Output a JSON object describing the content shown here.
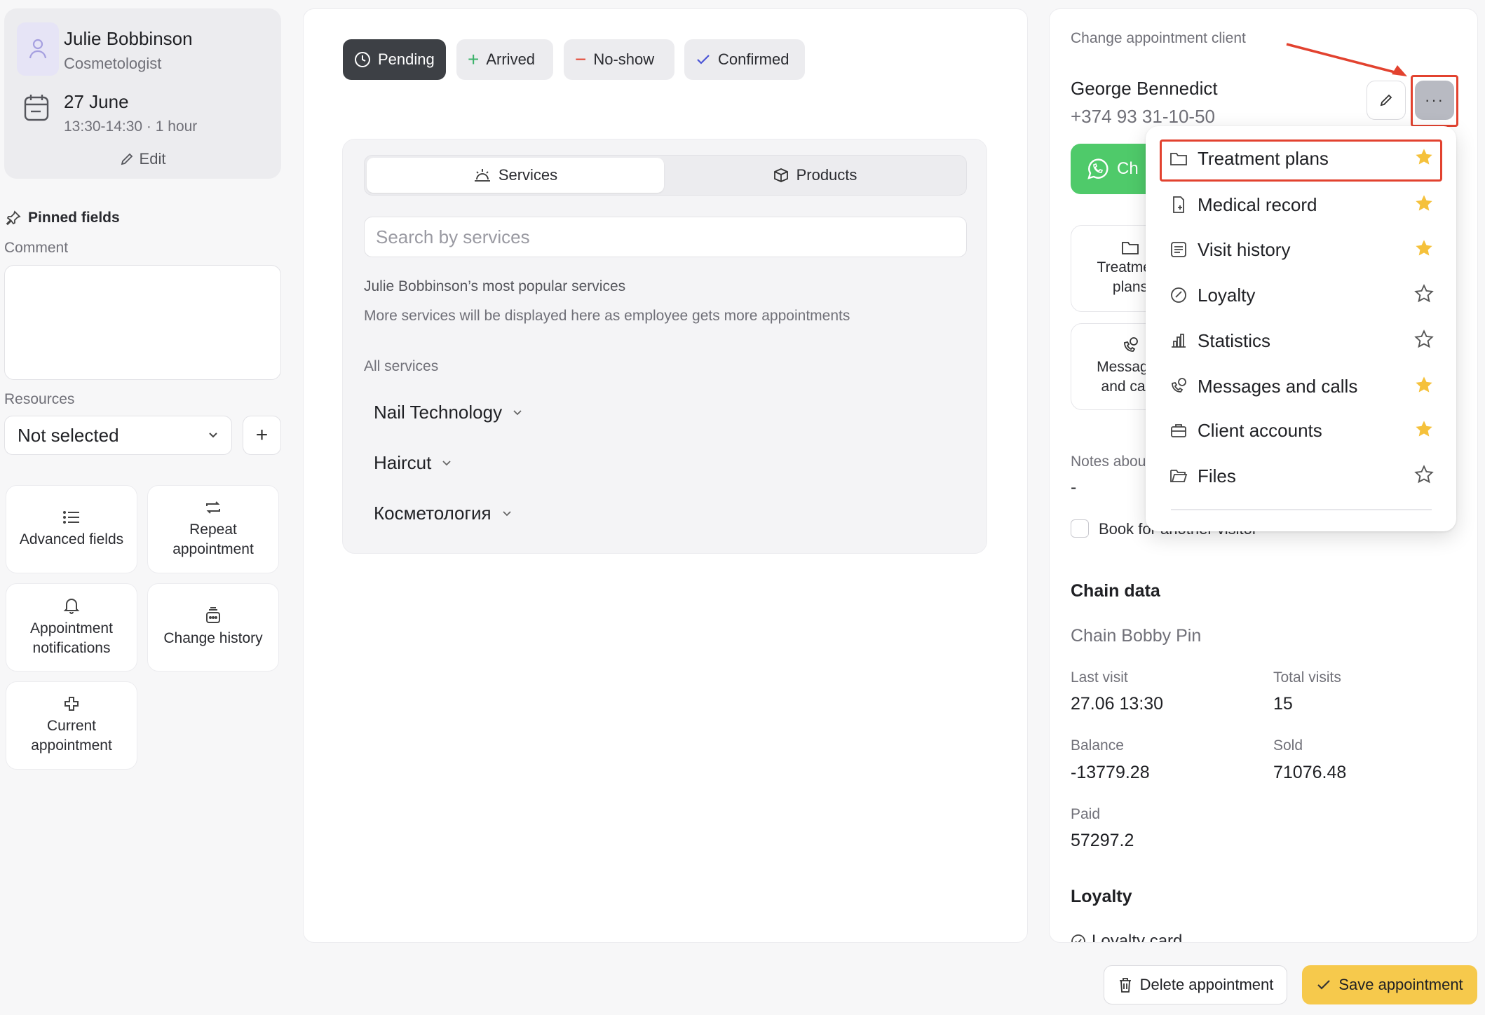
{
  "employee": {
    "name": "Julie Bobbinson",
    "role": "Cosmetologist",
    "date": "27 June",
    "time": "13:30-14:30 · 1 hour",
    "edit_label": "Edit"
  },
  "left": {
    "pinned_label": "Pinned fields",
    "comment_label": "Comment",
    "resources_label": "Resources",
    "resources_value": "Not selected",
    "tiles": [
      {
        "label": "Advanced fields",
        "icon": "list-icon"
      },
      {
        "label": "Repeat appointment",
        "icon": "repeat-icon"
      },
      {
        "label": "Appointment notifications",
        "icon": "bell-icon"
      },
      {
        "label": "Change history",
        "icon": "history-icon"
      },
      {
        "label": "Current appointment",
        "icon": "cross-icon"
      }
    ]
  },
  "statuses": [
    {
      "label": "Pending",
      "icon": "clock-icon",
      "active": true
    },
    {
      "label": "Arrived",
      "icon": "plus-icon",
      "color": "#3bb26a"
    },
    {
      "label": "No-show",
      "icon": "minus-icon",
      "color": "#e2422f"
    },
    {
      "label": "Confirmed",
      "icon": "check-icon",
      "color": "#4a54d6"
    }
  ],
  "services": {
    "tab_services": "Services",
    "tab_products": "Products",
    "search_placeholder": "Search by services",
    "popular_title": "Julie Bobbinson’s most popular services",
    "popular_note": "More services will be displayed here as employee gets more appointments",
    "all_label": "All services",
    "categories": [
      "Nail Technology",
      "Haircut",
      "Косметология"
    ]
  },
  "client": {
    "header": "Change appointment client",
    "name": "George Bennedict",
    "phone": "+374 93 31-10-50",
    "whatsapp_label": "Ch",
    "tile_treatment": "Treatment plans",
    "tile_messages": "Messages and calls",
    "notes_label": "Notes about",
    "notes_value": "-",
    "book_other": "Book for another visitor"
  },
  "menu": {
    "items": [
      {
        "label": "Treatment plans",
        "icon": "folder-icon",
        "starred": true
      },
      {
        "label": "Medical record",
        "icon": "medical-record-icon",
        "starred": true
      },
      {
        "label": "Visit history",
        "icon": "visit-history-icon",
        "starred": true
      },
      {
        "label": "Loyalty",
        "icon": "loyalty-icon",
        "starred": false
      },
      {
        "label": "Statistics",
        "icon": "statistics-icon",
        "starred": false
      },
      {
        "label": "Messages and calls",
        "icon": "phone-chat-icon",
        "starred": true
      },
      {
        "label": "Client accounts",
        "icon": "briefcase-icon",
        "starred": true
      },
      {
        "label": "Files",
        "icon": "folder-open-icon",
        "starred": false
      }
    ]
  },
  "chain": {
    "title": "Chain data",
    "name": "Chain Bobby Pin",
    "last_visit_label": "Last visit",
    "last_visit_value": "27.06 13:30",
    "total_visits_label": "Total visits",
    "total_visits_value": "15",
    "balance_label": "Balance",
    "balance_value": "-13779.28",
    "sold_label": "Sold",
    "sold_value": "71076.48",
    "paid_label": "Paid",
    "paid_value": "57297.2"
  },
  "loyalty": {
    "title": "Loyalty",
    "card_label": "Loyalty card"
  },
  "actions": {
    "delete_label": "Delete appointment",
    "save_label": "Save appointment"
  },
  "colors": {
    "accent_yellow": "#f6c94c",
    "star_yellow": "#f5c13b",
    "highlight_red": "#e2422f",
    "whatsapp_green": "#4fca6a"
  }
}
